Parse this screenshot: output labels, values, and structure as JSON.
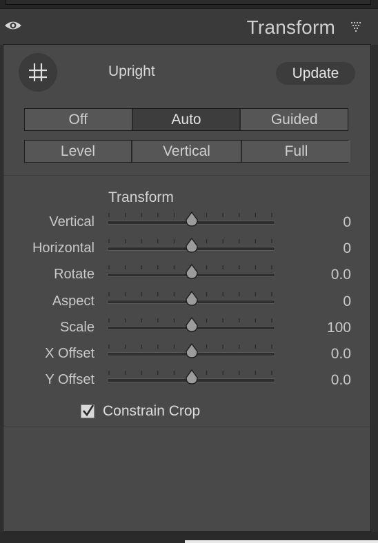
{
  "header": {
    "title": "Transform",
    "visibility_icon": "eye-icon",
    "collapse_icon": "triangle-down-icon"
  },
  "upright": {
    "crop_icon": "crop-grid-icon",
    "label": "Upright",
    "update_label": "Update",
    "modes_row1": [
      "Off",
      "Auto",
      "Guided"
    ],
    "modes_row2": [
      "Level",
      "Vertical",
      "Full"
    ],
    "active_mode": "Auto"
  },
  "transform": {
    "section_title": "Transform",
    "sliders": [
      {
        "label": "Vertical",
        "value": "0"
      },
      {
        "label": "Horizontal",
        "value": "0"
      },
      {
        "label": "Rotate",
        "value": "0.0"
      },
      {
        "label": "Aspect",
        "value": "0"
      },
      {
        "label": "Scale",
        "value": "100"
      },
      {
        "label": "X Offset",
        "value": "0.0"
      },
      {
        "label": "Y Offset",
        "value": "0.0"
      }
    ],
    "constrain_crop": {
      "label": "Constrain Crop",
      "checked": true
    }
  }
}
